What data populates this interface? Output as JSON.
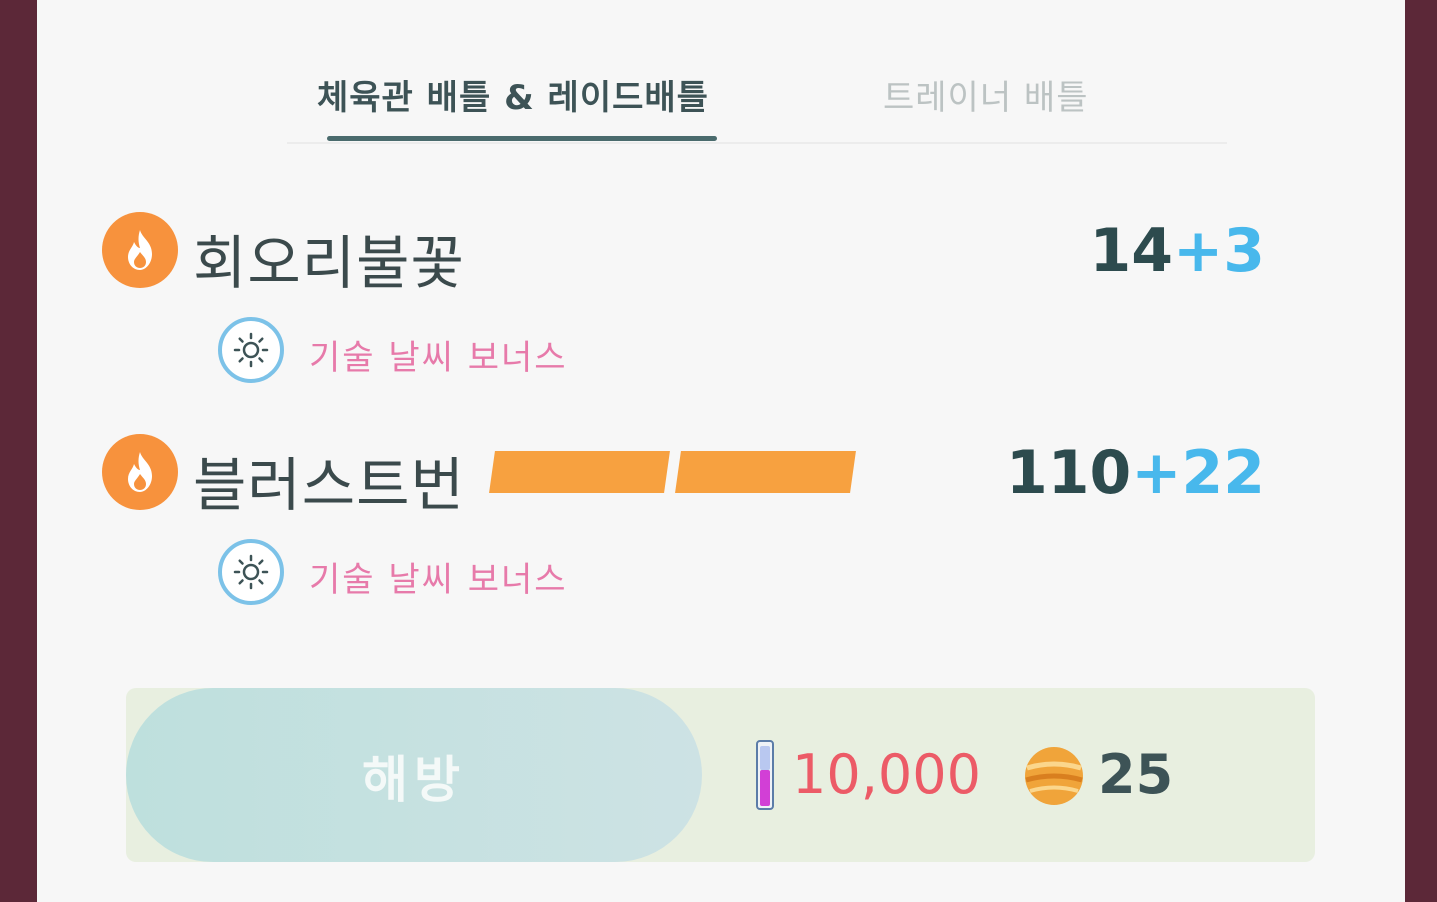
{
  "tabs": {
    "active_label": "체육관 배틀 & 레이드배틀",
    "inactive_label": "트레이너 배틀"
  },
  "moves": [
    {
      "name": "회오리불꽃",
      "type_icon": "fire-icon",
      "base_power": "14",
      "bonus_power": "+3",
      "weather_icon": "sunny-icon",
      "weather_label": "기술 날씨 보너스",
      "energy_bars": 0
    },
    {
      "name": "블러스트번",
      "type_icon": "fire-icon",
      "base_power": "110",
      "bonus_power": "+22",
      "weather_icon": "sunny-icon",
      "weather_label": "기술 날씨 보너스",
      "energy_bars": 2
    }
  ],
  "unlock": {
    "button_label": "해방",
    "stardust_icon": "stardust-icon",
    "stardust_cost": "10,000",
    "candy_icon": "candy-icon",
    "candy_cost": "25"
  },
  "colors": {
    "fire": "#f7923d",
    "bonus": "#48b8ec",
    "weather_text": "#e77aaa",
    "stardust_text": "#ec5b67",
    "frame": "#5c2838"
  }
}
